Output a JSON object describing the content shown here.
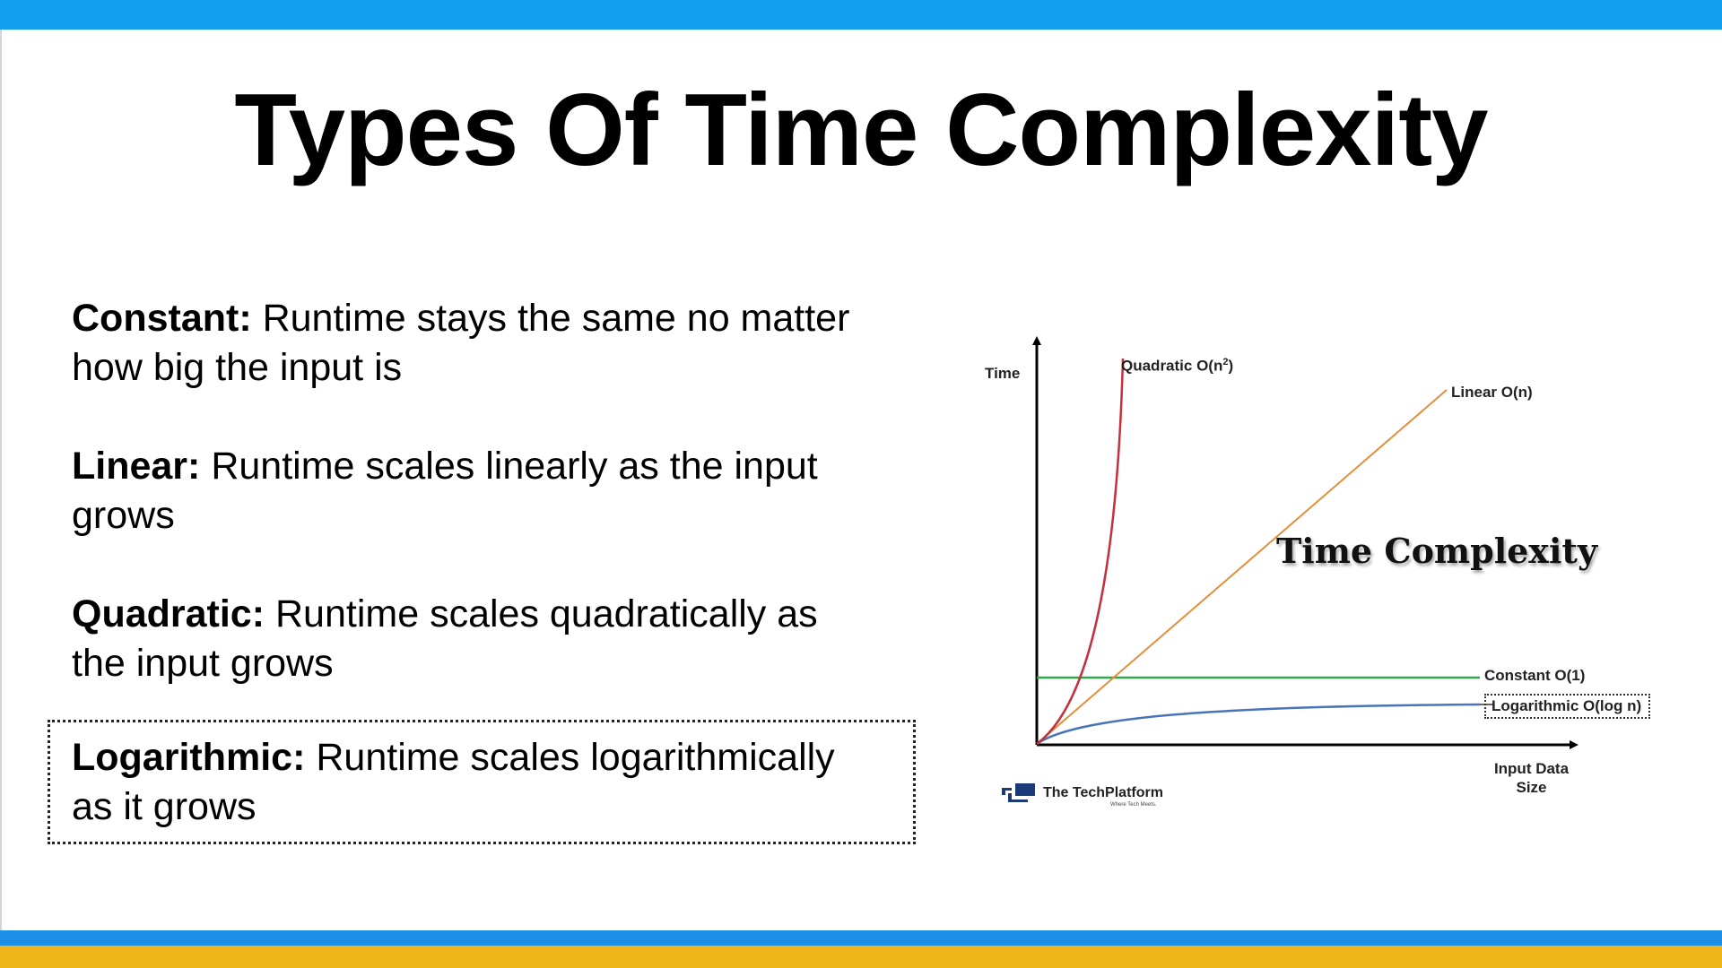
{
  "slide": {
    "title": "Types Of Time Complexity",
    "colors": {
      "top_bar": "#12a0ee",
      "bottom_blue": "#1d8fe6",
      "bottom_gold": "#efb418"
    }
  },
  "items": [
    {
      "term": "Constant:",
      "description": "Runtime stays the same no matter how big the input is"
    },
    {
      "term": "Linear:",
      "description": "Runtime scales linearly as the input grows"
    },
    {
      "term": "Quadratic:",
      "description": "Runtime scales quadratically as the input grows"
    },
    {
      "term": "Logarithmic:",
      "description": "Runtime scales logarithmically as it grows",
      "highlighted": true
    }
  ],
  "diagram": {
    "overlay_title": "Time Complexity",
    "y_axis_label": "Time",
    "x_axis_label_line1": "Input Data",
    "x_axis_label_line2": "Size",
    "curves": {
      "quadratic": {
        "label": "Quadratic O(n",
        "sup": "2",
        "suffix": ")",
        "color": "#c4303c"
      },
      "linear": {
        "label": "Linear O(n)",
        "color": "#e38f3a"
      },
      "constant": {
        "label": "Constant O(1)",
        "color": "#2ea84a"
      },
      "logarithmic": {
        "label": "Logarithmic O(log n)",
        "color": "#4a74b8"
      }
    },
    "logo": {
      "name": "The TechPlatform",
      "tagline": "Where Tech Meets.",
      "color": "#1a3a7a"
    }
  }
}
